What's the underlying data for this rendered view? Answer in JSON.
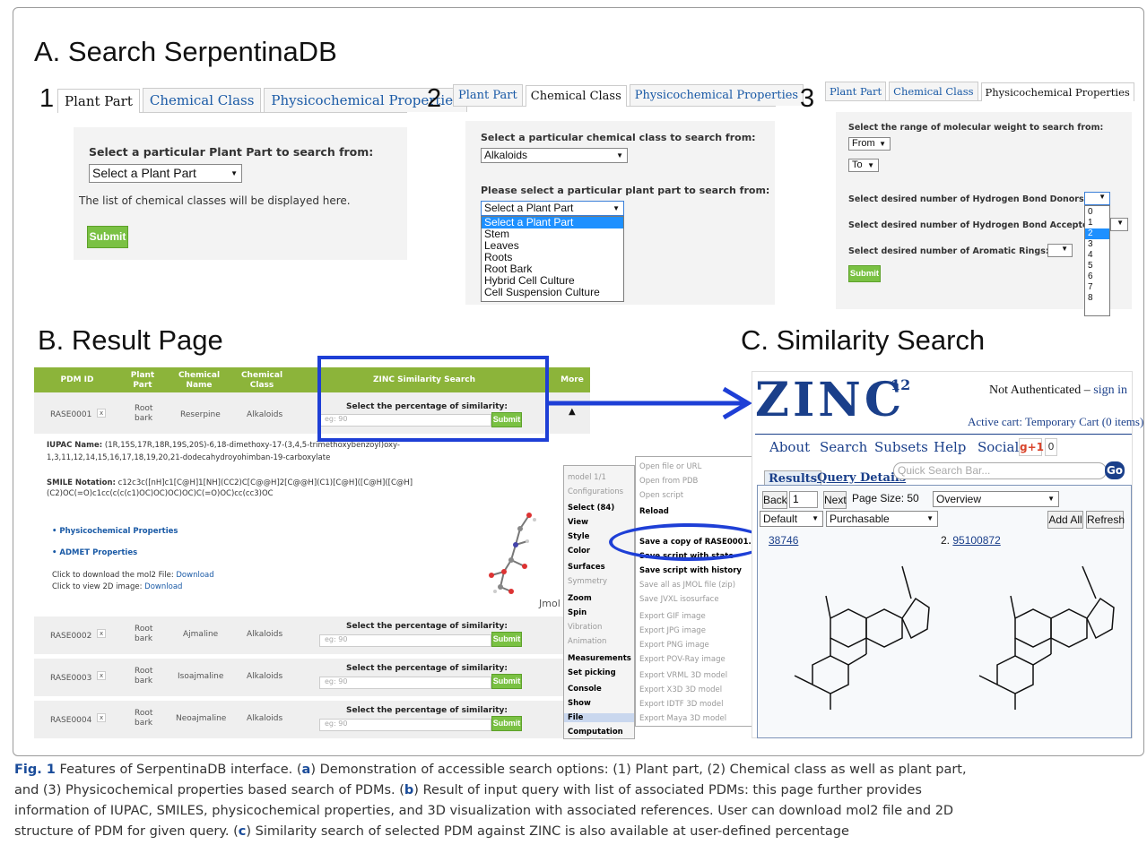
{
  "sections": {
    "a": "A. Search SerpentinaDB",
    "b": "B. Result Page",
    "c": "C. Similarity Search"
  },
  "steps": [
    "1",
    "2",
    "3"
  ],
  "tabs": {
    "plant": "Plant Part",
    "chem": "Chemical Class",
    "phys": "Physicochemical Properties"
  },
  "panel1": {
    "prompt": "Select a particular Plant Part to search from:",
    "select": "Select a Plant Part",
    "note": "The list of chemical classes will be displayed here.",
    "submit": "Submit"
  },
  "panel2": {
    "prompt1": "Select a particular chemical class to search from:",
    "class_value": "Alkaloids",
    "prompt2": "Please select a particular plant part to search from:",
    "select": "Select a Plant Part",
    "options": [
      "Select a Plant Part",
      "Stem",
      "Leaves",
      "Roots",
      "Root Bark",
      "Hybrid Cell Culture",
      "Cell Suspension Culture"
    ]
  },
  "panel3": {
    "prompt_mw": "Select the range of molecular weight to search from:",
    "from": "From",
    "to": "To",
    "donors": "Select desired number of Hydrogen Bond Donors:",
    "acceptors": "Select desired number of Hydrogen Bond Acceptor",
    "rings": "Select desired number of Aromatic Rings:",
    "submit": "Submit",
    "numbers": [
      "0",
      "1",
      "2",
      "3",
      "4",
      "5",
      "6",
      "7",
      "8"
    ]
  },
  "table": {
    "headers": [
      "PDM ID",
      "Plant Part",
      "Chemical Name",
      "Chemical Class",
      "ZINC Similarity Search",
      "More"
    ],
    "rows": [
      {
        "id": "RASE0001",
        "part": "Root bark",
        "name": "Reserpine",
        "class": "Alkaloids"
      },
      {
        "id": "RASE0002",
        "part": "Root bark",
        "name": "Ajmaline",
        "class": "Alkaloids"
      },
      {
        "id": "RASE0003",
        "part": "Root bark",
        "name": "Isoajmaline",
        "class": "Alkaloids"
      },
      {
        "id": "RASE0004",
        "part": "Root bark",
        "name": "Neoajmaline",
        "class": "Alkaloids"
      }
    ],
    "sim_label": "Select the percentage of similarity:",
    "placeholder": "eg: 90",
    "submit": "Submit",
    "x": "x"
  },
  "detail": {
    "iupac_label": "IUPAC Name:",
    "iupac1": "(1R,15S,17R,18R,19S,20S)-6,18-dimethoxy-17-(3,4,5-trimethoxybenzoyl)oxy-",
    "iupac2": "1,3,11,12,14,15,16,17,18,19,20,21-dodecahydroyohimban-19-carboxylate",
    "smile_label": "SMILE Notation:",
    "smile1": "c12c3c([nH]c1[C@H]1[NH](CC2)C[C@@H]2[C@@H](C1)[C@H]([C@H]([C@H]",
    "smile2": "(C2)OC(=O)c1cc(c(c(c1)OC)OC)OC)OC)C(=O)OC)cc(cc3)OC",
    "link1": "Physicochemical Properties",
    "link2": "ADMET Properties",
    "mol2_text": "Click to download the mol2 File:",
    "img_text": "Click to view 2D image:",
    "download": "Download",
    "jmol": "Jmol"
  },
  "menu": {
    "left": [
      "model 1/1",
      "Configurations",
      "Select (84)",
      "View",
      "Style",
      "Color",
      "Surfaces",
      "Symmetry",
      "Zoom",
      "Spin",
      "Vibration",
      "Animation",
      "Measurements",
      "Set picking",
      "Console",
      "Show",
      "File",
      "Computation"
    ],
    "right": [
      "Open file or URL",
      "Open from PDB",
      "Open script",
      "Reload",
      "",
      "Save a copy of RASE0001.mol2",
      "Save script with state",
      "Save script with history",
      "Save all as JMOL file (zip)",
      "Save JVXL isosurface",
      "Export GIF image",
      "Export JPG image",
      "Export PNG image",
      "Export POV-Ray image",
      "Export VRML 3D model",
      "Export X3D 3D model",
      "Export IDTF 3D model",
      "Export Maya 3D model"
    ]
  },
  "zinc": {
    "logo": "ZINC",
    "version": "12",
    "auth": "Not Authenticated",
    "sign": "sign in",
    "dash": "–",
    "cart": "Active cart: Temporary Cart (0 items)",
    "nav": [
      "About",
      "Search",
      "Subsets",
      "Help",
      "Social"
    ],
    "gplus": "g+1",
    "count": "0",
    "tabs": [
      "Results",
      "Query Details"
    ],
    "search_ph": "Quick Search Bar...",
    "go": "Go",
    "back": "Back",
    "page": "1",
    "next": "Next",
    "pagesize": "Page Size: 50",
    "overview": "Overview",
    "default": "Default",
    "purch": "Purchasable",
    "addall": "Add All",
    "refresh": "Refresh",
    "item1": "38746",
    "item2_num": "2.",
    "item2": "95100872"
  },
  "caption": {
    "fig": "Fig. 1",
    "title": " Features of SerpentinaDB interface. (",
    "a": "a",
    "ta": ") Demonstration of accessible search options: (1) Plant part, (2) Chemical class as well as plant part,",
    "l2": "and (3) Physicochemical properties based search of PDMs. (",
    "b": "b",
    "tb": ") Result of input query with list of associated PDMs: this page further provides",
    "l3": "information of IUPAC, SMILES, physicochemical properties, and 3D visualization with associated references. User can download mol2 file and 2D",
    "l4": "structure of PDM for given query. (",
    "c": "c",
    "tc": ") Similarity search of selected PDM against ZINC is also available at user-defined percentage"
  },
  "colors": {
    "green": "#8cb43a",
    "button": "#7ac143",
    "blue": "#1a5aa6",
    "highlight": "#1e5bd6",
    "zinc": "#1a3f8a"
  }
}
